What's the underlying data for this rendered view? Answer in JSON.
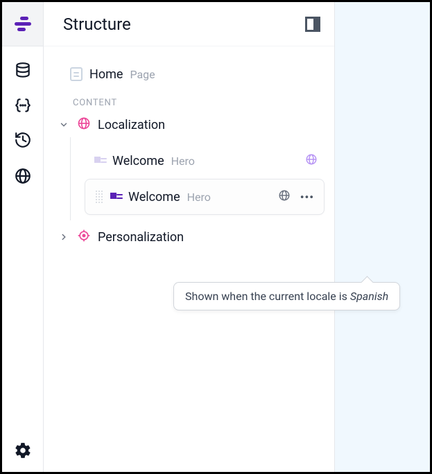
{
  "panel": {
    "title": "Structure"
  },
  "rail": {
    "logo": "builder-logo",
    "icons": [
      "database",
      "braces",
      "history",
      "globe"
    ],
    "settings": "settings"
  },
  "root": {
    "name": "Home",
    "type": "Page"
  },
  "section_label": "CONTENT",
  "groups": [
    {
      "name": "Localization",
      "expanded": true,
      "icon": "globe",
      "icon_color": "#ec4899",
      "children": [
        {
          "name": "Welcome",
          "type": "Hero",
          "locale_icon_color": "#b794f4",
          "selected": false
        },
        {
          "name": "Welcome",
          "type": "Hero",
          "locale_icon_color": "#6b7280",
          "selected": true
        }
      ]
    },
    {
      "name": "Personalization",
      "expanded": false,
      "icon": "target",
      "icon_color": "#ec4899"
    }
  ],
  "tooltip": {
    "prefix": "Shown when the current locale is ",
    "value": "Spanish"
  }
}
